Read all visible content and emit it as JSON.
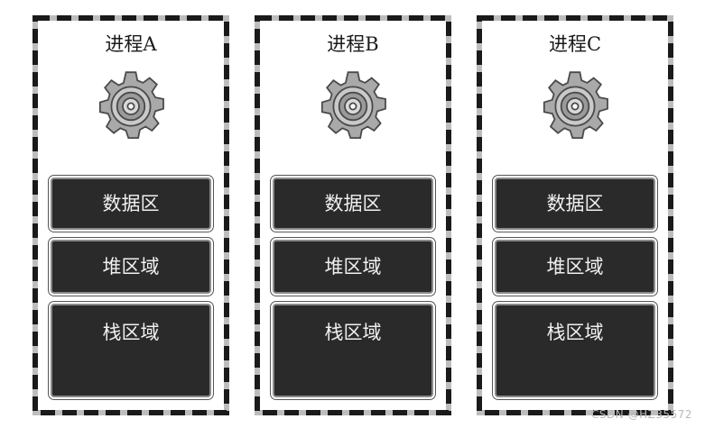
{
  "processes": [
    {
      "title": "进程A",
      "segments": {
        "data": "数据区",
        "heap": "堆区域",
        "stack": "栈区域"
      },
      "icon": "gear-icon"
    },
    {
      "title": "进程B",
      "segments": {
        "data": "数据区",
        "heap": "堆区域",
        "stack": "栈区域"
      },
      "icon": "gear-icon"
    },
    {
      "title": "进程C",
      "segments": {
        "data": "数据区",
        "heap": "堆区域",
        "stack": "栈区域"
      },
      "icon": "gear-icon"
    }
  ],
  "watermark": "CSDN @HZ35572",
  "colors": {
    "segment_fill": "#2a2a2a",
    "frame": "#1a1a1a",
    "gear": "#9a9a9a"
  }
}
